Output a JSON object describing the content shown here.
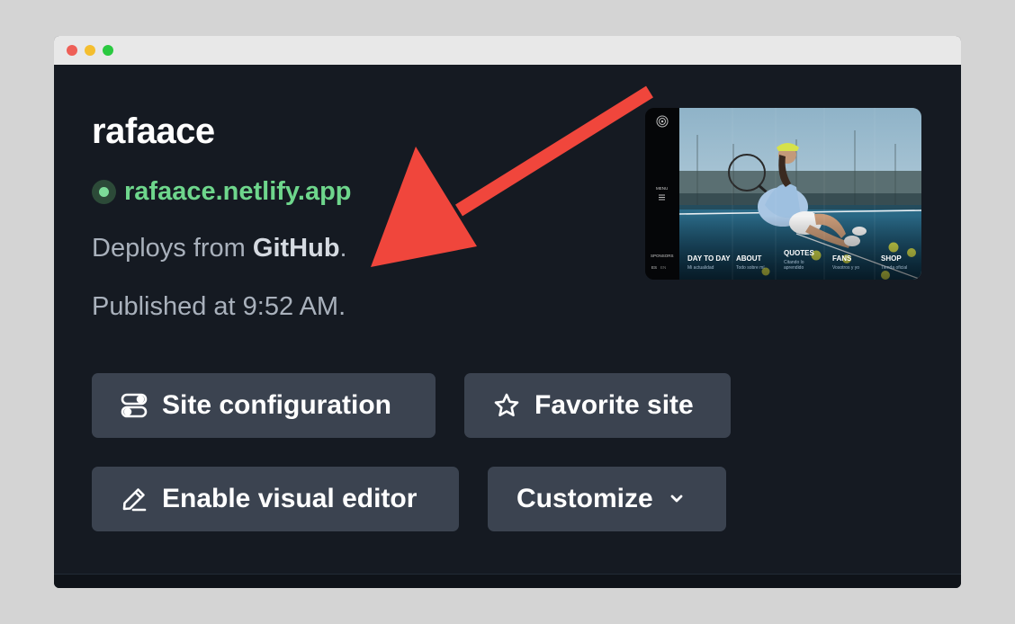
{
  "site": {
    "name": "rafaace",
    "url": "rafaace.netlify.app",
    "deploy_prefix": "Deploys from ",
    "deploy_source": "GitHub",
    "deploy_suffix": ".",
    "published": "Published at 9:52 AM."
  },
  "actions": {
    "site_configuration": "Site configuration",
    "favorite_site": "Favorite site",
    "enable_visual_editor": "Enable visual editor",
    "customize": "Customize"
  },
  "thumbnail": {
    "menu_label": "MENU",
    "sponsors_label": "SPONSORS",
    "lang_es": "ES",
    "lang_en": "EN",
    "nav": [
      {
        "label": "DAY TO DAY",
        "sub": "Mi actualidad"
      },
      {
        "label": "ABOUT",
        "sub": "Todo sobre mí"
      },
      {
        "label": "QUOTES",
        "sub": "Citando lo aprendido"
      },
      {
        "label": "FANS",
        "sub": "Vosotros y yo"
      },
      {
        "label": "SHOP",
        "sub": "Tienda oficial"
      }
    ]
  },
  "icons": {
    "status": "status-dot-icon",
    "config": "toggles-icon",
    "favorite": "star-icon",
    "editor": "pencil-icon",
    "customize": "chevron-down-icon"
  },
  "colors": {
    "background": "#151a22",
    "button": "#3b4350",
    "url_green": "#6ed68c",
    "annotation_arrow": "#f0463c"
  }
}
